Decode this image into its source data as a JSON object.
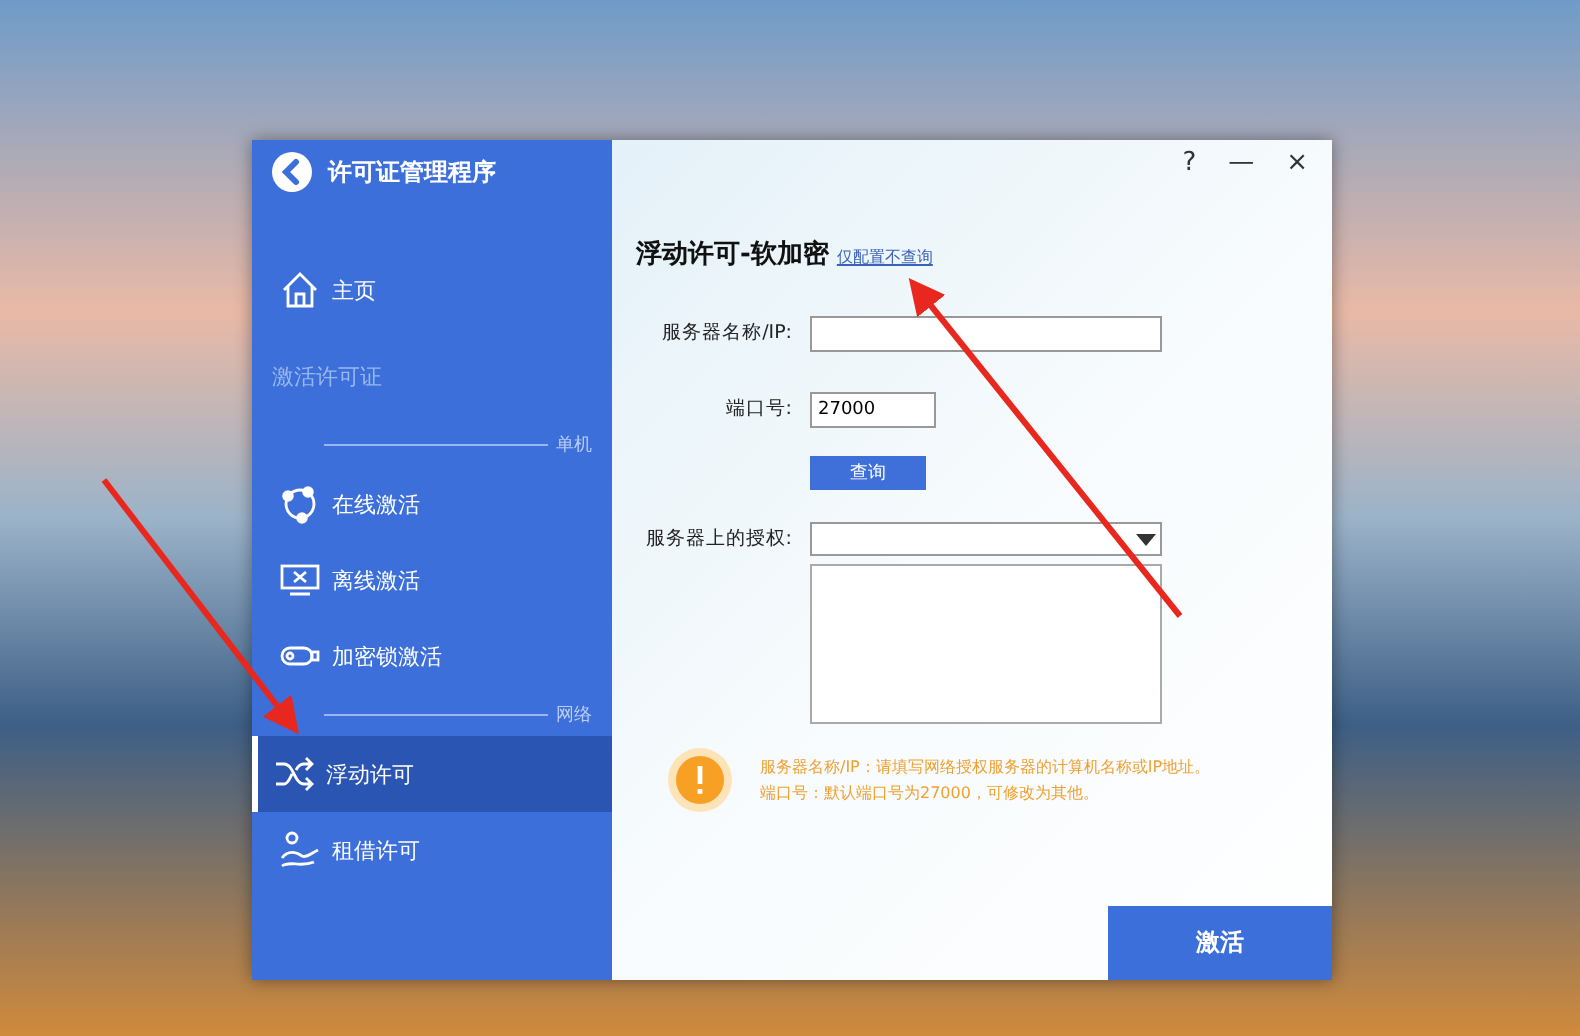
{
  "window": {
    "title": "许可证管理程序",
    "controls": [
      "?",
      "—",
      "×"
    ]
  },
  "sidebar": {
    "items": [
      {
        "kind": "nav",
        "label": "主页",
        "selected": false
      },
      {
        "kind": "heading",
        "label": "激活许可证"
      },
      {
        "kind": "divider",
        "label": "单机"
      },
      {
        "kind": "nav",
        "label": "在线激活",
        "selected": false
      },
      {
        "kind": "nav",
        "label": "离线激活",
        "selected": false
      },
      {
        "kind": "nav",
        "label": "加密锁激活",
        "selected": false
      },
      {
        "kind": "divider",
        "label": "网络"
      },
      {
        "kind": "nav",
        "label": "浮动许可",
        "selected": true
      },
      {
        "kind": "nav",
        "label": "租借许可",
        "selected": false
      }
    ]
  },
  "content": {
    "title": "浮动许可-软加密",
    "link": "仅配置不查询",
    "server": {
      "label": "服务器名称/IP:"
    },
    "port": {
      "label": "端口号:",
      "value": "27000"
    },
    "query_button": "查询",
    "licenses": {
      "label": "服务器上的授权:"
    },
    "tips": [
      "服务器名称/IP：请填写网络授权服务器的计算机名称或IP地址。",
      "端口号：默认端口号为27000，可修改为其他。"
    ],
    "activate_button": "激活"
  }
}
